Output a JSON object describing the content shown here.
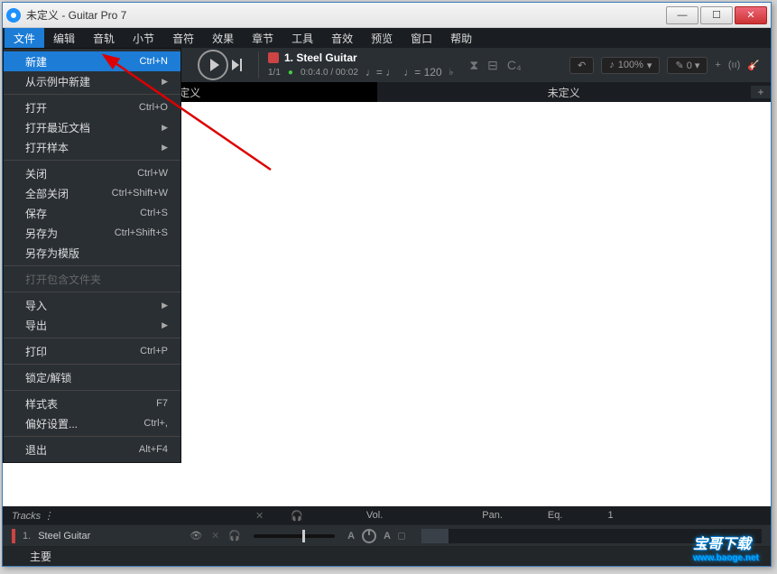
{
  "window": {
    "title": "未定义 - Guitar Pro 7"
  },
  "win_controls": {
    "min": "—",
    "max": "☐",
    "close": "✕"
  },
  "menubar": [
    {
      "label": "文件",
      "active": true
    },
    {
      "label": "编辑"
    },
    {
      "label": "音轨"
    },
    {
      "label": "小节"
    },
    {
      "label": "音符"
    },
    {
      "label": "效果"
    },
    {
      "label": "章节"
    },
    {
      "label": "工具"
    },
    {
      "label": "音效"
    },
    {
      "label": "预览"
    },
    {
      "label": "窗口"
    },
    {
      "label": "帮助"
    }
  ],
  "file_menu": [
    {
      "label": "新建",
      "shortcut": "Ctrl+N",
      "highlight": true
    },
    {
      "label": "从示例中新建",
      "submenu": true
    },
    {
      "sep": true
    },
    {
      "label": "打开",
      "shortcut": "Ctrl+O"
    },
    {
      "label": "打开最近文档",
      "submenu": true
    },
    {
      "label": "打开样本",
      "submenu": true
    },
    {
      "sep": true
    },
    {
      "label": "关闭",
      "shortcut": "Ctrl+W"
    },
    {
      "label": "全部关闭",
      "shortcut": "Ctrl+Shift+W"
    },
    {
      "label": "保存",
      "shortcut": "Ctrl+S"
    },
    {
      "label": "另存为",
      "shortcut": "Ctrl+Shift+S"
    },
    {
      "label": "另存为模版"
    },
    {
      "sep": true
    },
    {
      "label": "打开包含文件夹",
      "disabled": true
    },
    {
      "sep": true
    },
    {
      "label": "导入",
      "submenu": true
    },
    {
      "label": "导出",
      "submenu": true
    },
    {
      "sep": true
    },
    {
      "label": "打印",
      "shortcut": "Ctrl+P"
    },
    {
      "sep": true
    },
    {
      "label": "锁定/解锁"
    },
    {
      "sep": true
    },
    {
      "label": "样式表",
      "shortcut": "F7"
    },
    {
      "label": "偏好设置...",
      "shortcut": "Ctrl+,"
    },
    {
      "sep": true
    },
    {
      "label": "退出",
      "shortcut": "Alt+F4"
    }
  ],
  "track_info": {
    "title": "1. Steel Guitar",
    "bar": "1/1",
    "time": "0:0:4.0 / 00:02",
    "sig": "♩= ♩",
    "tempo": "♩= 120",
    "tuning": "♭"
  },
  "zoom": {
    "value": "100%"
  },
  "tabs": {
    "left": "定义",
    "right": "未定义",
    "add": "+"
  },
  "tracks_header": {
    "tracks": "Tracks  ⋮",
    "vol": "Vol.",
    "pan": "Pan.",
    "eq": "Eq.",
    "num": "1"
  },
  "track_row": {
    "num": "1.",
    "name": "Steel Guitar",
    "a1": "A",
    "a2": "A"
  },
  "master_row": {
    "label": "主要"
  },
  "watermark": {
    "text": "宝哥下载",
    "url": "www.baoge.net"
  }
}
